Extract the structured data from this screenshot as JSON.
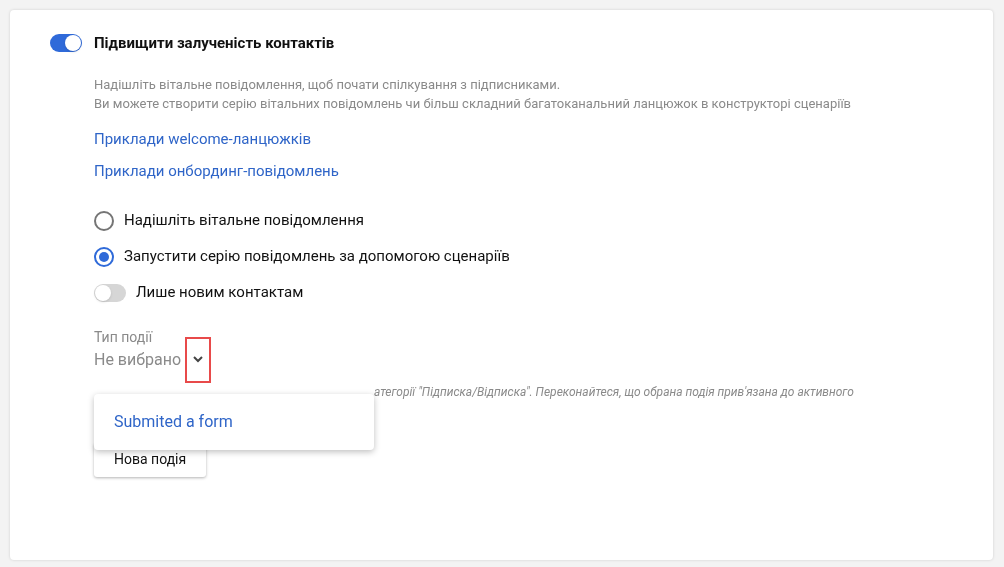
{
  "engagement": {
    "title": "Підвищити залученість контактів",
    "on": true
  },
  "description": [
    "Надішліть вітальне повідомлення, щоб почати спілкування з підписниками.",
    "Ви можете створити серію вітальних повідомлень чи більш складний багатоканальний ланцюжок в конструкторі сценаріїв"
  ],
  "links": [
    "Приклади welcome-ланцюжків",
    "Приклади онбординг-повідомлень"
  ],
  "options": [
    {
      "kind": "radio",
      "label": "Надішліть вітальне повідомлення",
      "selected": false
    },
    {
      "kind": "radio",
      "label": "Запустити серію повідомлень за допомогою сценаріїв",
      "selected": true
    },
    {
      "kind": "toggle",
      "label": "Лише новим контактам",
      "on": false
    }
  ],
  "event_type": {
    "label": "Тип події",
    "value": "Не вибрано",
    "highlighted": true,
    "expanded": true,
    "hint": "атегорії \"Підписка/Відписка\". Переконайтеся, що обрана подія прив'язана до активного",
    "menu_items": [
      "Submited a form"
    ]
  },
  "new_event_button": "Нова подія"
}
